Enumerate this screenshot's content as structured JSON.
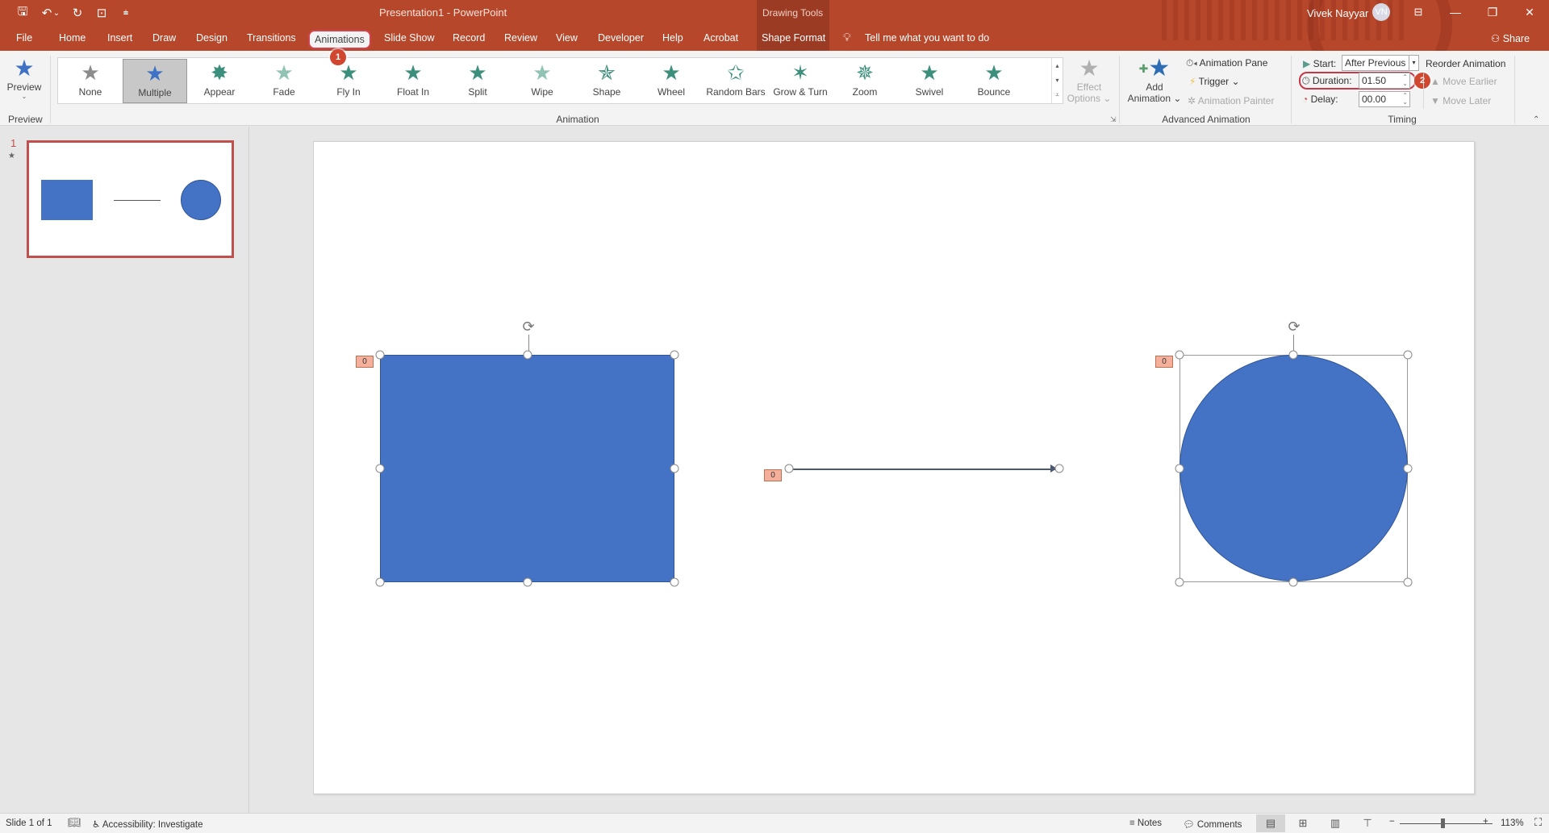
{
  "titlebar": {
    "window_title": "Presentation1  -  PowerPoint",
    "context_group": "Drawing Tools",
    "user_name": "Vivek Nayyar",
    "user_initials": "VN",
    "qat": [
      {
        "name": "save-icon",
        "glyph": "🖫"
      },
      {
        "name": "undo-icon",
        "glyph": "↶"
      },
      {
        "name": "undo-dropdown-icon",
        "glyph": "⌄"
      },
      {
        "name": "redo-icon",
        "glyph": "↻"
      },
      {
        "name": "present-from-start-icon",
        "glyph": "⊡"
      },
      {
        "name": "customize-qat-icon",
        "glyph": "⩧"
      }
    ],
    "window_buttons": {
      "ribbon_display": "⊟",
      "minimize": "—",
      "restore": "❐",
      "close": "✕"
    }
  },
  "tabs": [
    {
      "label": "File"
    },
    {
      "label": "Home"
    },
    {
      "label": "Insert"
    },
    {
      "label": "Draw"
    },
    {
      "label": "Design"
    },
    {
      "label": "Transitions"
    },
    {
      "label": "Animations",
      "active": true
    },
    {
      "label": "Slide Show"
    },
    {
      "label": "Record"
    },
    {
      "label": "Review"
    },
    {
      "label": "View"
    },
    {
      "label": "Developer"
    },
    {
      "label": "Help"
    },
    {
      "label": "Acrobat"
    },
    {
      "label": "Shape Format"
    }
  ],
  "tell_me": "Tell me what you want to do",
  "share_label": "Share",
  "callouts": {
    "one": "1",
    "two": "2"
  },
  "ribbon": {
    "preview": {
      "label": "Preview",
      "group": "Preview"
    },
    "animation_group": "Animation",
    "gallery": [
      {
        "label": "None",
        "glyph": "★",
        "color": "#8c8c8c"
      },
      {
        "label": "Multiple",
        "glyph": "★",
        "color": "#3f72c4",
        "selected": true
      },
      {
        "label": "Appear",
        "glyph": "✸",
        "color": "#3d8f7d"
      },
      {
        "label": "Fade",
        "glyph": "★",
        "color": "#8fc4b5"
      },
      {
        "label": "Fly In",
        "glyph": "★",
        "color": "#3d8f7d"
      },
      {
        "label": "Float In",
        "glyph": "★",
        "color": "#3d8f7d"
      },
      {
        "label": "Split",
        "glyph": "★",
        "color": "#3d8f7d"
      },
      {
        "label": "Wipe",
        "glyph": "★",
        "color": "#8fc4b5"
      },
      {
        "label": "Shape",
        "glyph": "✯",
        "color": "#3d8f7d"
      },
      {
        "label": "Wheel",
        "glyph": "★",
        "color": "#3d8f7d"
      },
      {
        "label": "Random Bars",
        "glyph": "✩",
        "color": "#3d8f7d"
      },
      {
        "label": "Grow & Turn",
        "glyph": "✶",
        "color": "#3d8f7d"
      },
      {
        "label": "Zoom",
        "glyph": "✵",
        "color": "#3d8f7d"
      },
      {
        "label": "Swivel",
        "glyph": "★",
        "color": "#3d8f7d"
      },
      {
        "label": "Bounce",
        "glyph": "★",
        "color": "#3d8f7d"
      }
    ],
    "effect_options": {
      "line1": "Effect",
      "line2": "Options ⌄"
    },
    "advanced": {
      "group": "Advanced Animation",
      "add_animation_1": "Add",
      "add_animation_2": "Animation ⌄",
      "animation_pane": "Animation Pane",
      "trigger": "Trigger ⌄",
      "animation_painter": "Animation Painter"
    },
    "timing": {
      "group": "Timing",
      "start_label": "Start:",
      "start_value": "After Previous",
      "duration_label": "Duration:",
      "duration_value": "01.50",
      "delay_label": "Delay:",
      "delay_value": "00.00",
      "reorder": "Reorder Animation",
      "move_earlier": "Move Earlier",
      "move_later": "Move Later"
    }
  },
  "slides_pane": {
    "slide_number": "1",
    "anim_marker": "★"
  },
  "slide": {
    "shape_fill": "#4472c4",
    "animation_tags": [
      "0",
      "0",
      "0"
    ]
  },
  "statusbar": {
    "slide_info": "Slide 1 of 1",
    "accessibility": "Accessibility: Investigate",
    "notes": "Notes",
    "comments": "Comments",
    "zoom_level": "113%",
    "zoom_minus": "−",
    "zoom_plus": "+"
  }
}
